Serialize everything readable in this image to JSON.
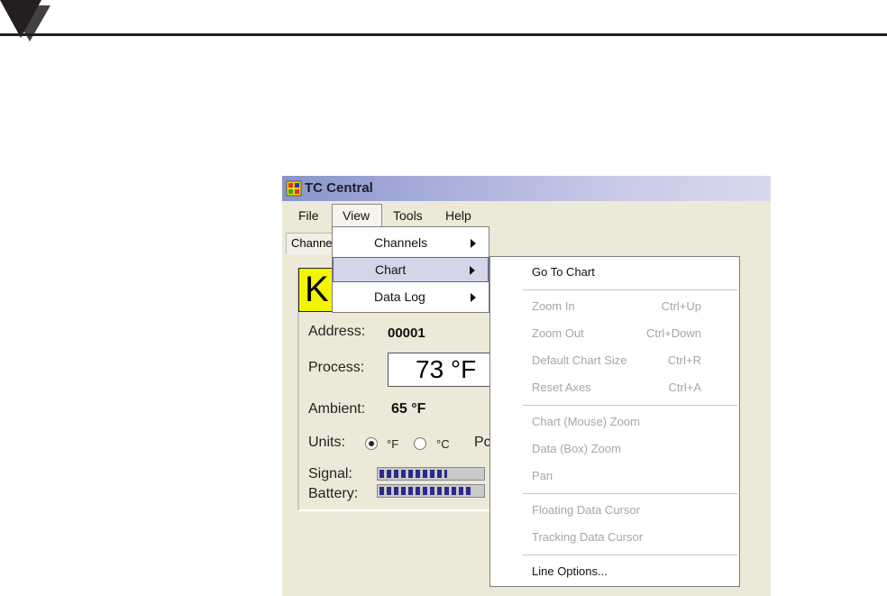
{
  "window": {
    "title": "TC Central"
  },
  "menubar": {
    "items": [
      "File",
      "View",
      "Tools",
      "Help"
    ]
  },
  "tabs": {
    "channels_label": "Channels"
  },
  "device": {
    "type_letter": "K",
    "address_label": "Address:",
    "address_value": "00001",
    "process_label": "Process:",
    "process_value": "73 °F",
    "ambient_label": "Ambient:",
    "ambient_value": "65 °F",
    "units_label": "Units:",
    "unit_f": "°F",
    "unit_c": "°C",
    "units_selected": "°F",
    "extra_label": "Pc",
    "signal_label": "Signal:",
    "signal_level": 0.65,
    "battery_label": "Battery:",
    "battery_level": 0.9
  },
  "view_menu": {
    "items": [
      {
        "label": "Channels",
        "submenu": true
      },
      {
        "label": "Chart",
        "submenu": true,
        "highlighted": true
      },
      {
        "label": "Data Log",
        "submenu": true
      }
    ]
  },
  "chart_menu": {
    "go_to_chart": "Go To Chart",
    "zoom_in": "Zoom In",
    "zoom_in_shortcut": "Ctrl+Up",
    "zoom_out": "Zoom Out",
    "zoom_out_shortcut": "Ctrl+Down",
    "default_size": "Default Chart Size",
    "default_size_shortcut": "Ctrl+R",
    "reset_axes": "Reset Axes",
    "reset_axes_shortcut": "Ctrl+A",
    "chart_mouse_zoom": "Chart (Mouse) Zoom",
    "data_box_zoom": "Data (Box) Zoom",
    "pan": "Pan",
    "floating_cursor": "Floating Data Cursor",
    "tracking_cursor": "Tracking Data Cursor",
    "line_options": "Line Options..."
  },
  "colors": {
    "title_bar": "#8a94c9",
    "highlight": "#d5d5ea",
    "k_badge": "#f4f500",
    "meter": "#2b2a8a"
  }
}
